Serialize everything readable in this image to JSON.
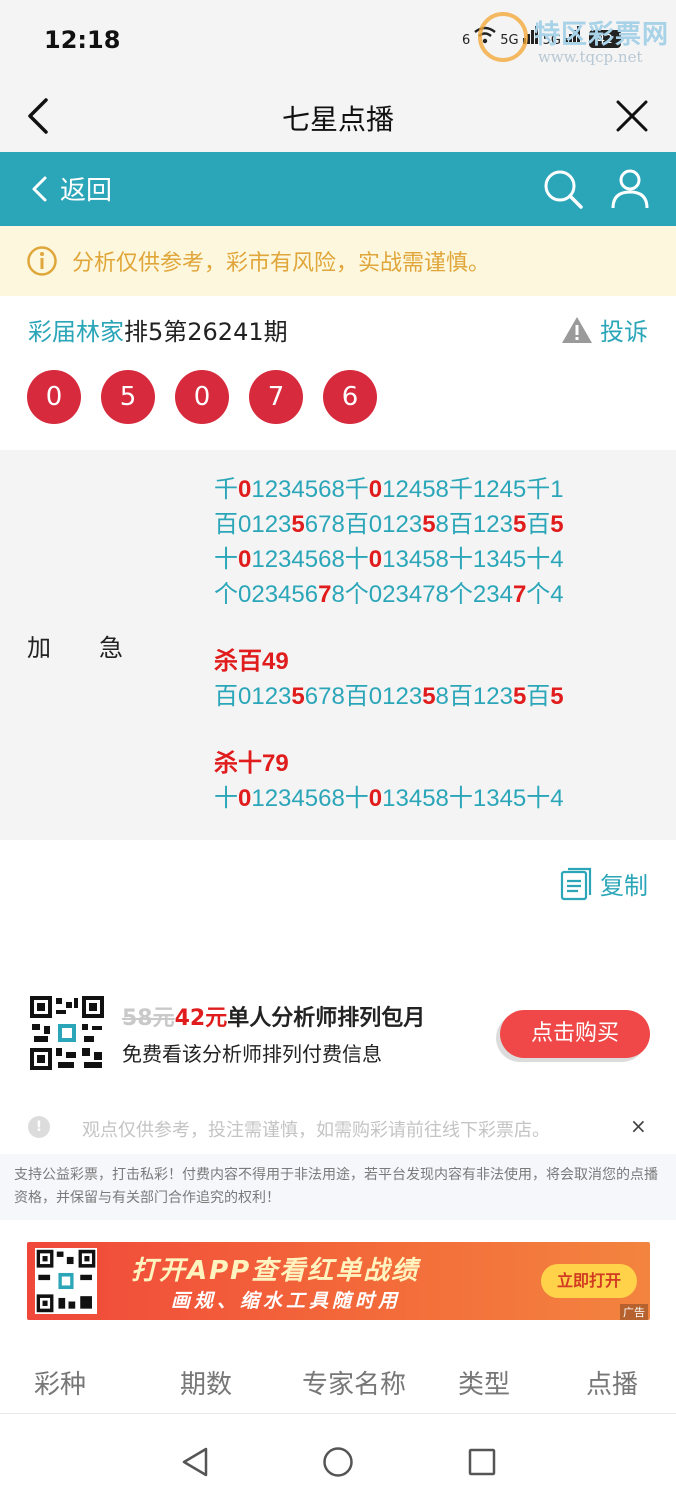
{
  "status": {
    "time": "12:18",
    "net1": "6",
    "net2": "5G",
    "net3": "5G",
    "battery": "42"
  },
  "watermark": {
    "title": "特区彩票网",
    "url": "www.tqcp.net"
  },
  "nav": {
    "title": "七星点播"
  },
  "toolbar": {
    "back_label": "返回"
  },
  "notice": {
    "text": "分析仅供参考，彩市有风险，实战需谨慎。"
  },
  "prediction": {
    "expert_name": "彩届林家",
    "issue_text": "排5第26241期",
    "complaint_label": "投诉",
    "balls": [
      "0",
      "5",
      "0",
      "7",
      "6"
    ],
    "type_label": "加急",
    "lines": {
      "l1": [
        {
          "t": "千"
        },
        {
          "t": "0",
          "r": 1
        },
        {
          "t": "1234568千"
        },
        {
          "t": "0",
          "r": 1
        },
        {
          "t": "12458千1245千1"
        }
      ],
      "l2": [
        {
          "t": "百0123"
        },
        {
          "t": "5",
          "r": 1
        },
        {
          "t": "678百0123"
        },
        {
          "t": "5",
          "r": 1
        },
        {
          "t": "8百123"
        },
        {
          "t": "5",
          "r": 1
        },
        {
          "t": "百"
        },
        {
          "t": "5",
          "r": 1
        }
      ],
      "l3": [
        {
          "t": "十"
        },
        {
          "t": "0",
          "r": 1
        },
        {
          "t": "1234568十"
        },
        {
          "t": "0",
          "r": 1
        },
        {
          "t": "13458十1345十4"
        }
      ],
      "l4": [
        {
          "t": "个023456"
        },
        {
          "t": "7",
          "r": 1
        },
        {
          "t": "8个02347"
        },
        {
          "t": "8个234"
        },
        {
          "t": "7",
          "r": 1
        },
        {
          "t": "个4"
        }
      ],
      "kill1": "杀百49",
      "l5": [
        {
          "t": "百0123"
        },
        {
          "t": "5",
          "r": 1
        },
        {
          "t": "678百0123"
        },
        {
          "t": "5",
          "r": 1
        },
        {
          "t": "8百123"
        },
        {
          "t": "5",
          "r": 1
        },
        {
          "t": "百"
        },
        {
          "t": "5",
          "r": 1
        }
      ],
      "kill2": "杀十79",
      "l6": [
        {
          "t": "十"
        },
        {
          "t": "0",
          "r": 1
        },
        {
          "t": "1234568十"
        },
        {
          "t": "0",
          "r": 1
        },
        {
          "t": "13458十1345十4"
        }
      ]
    },
    "copy_label": "复制"
  },
  "promo": {
    "old_price": "58元",
    "new_price": "42元",
    "title": "单人分析师排列包月",
    "subtitle": "免费看该分析师排列付费信息",
    "buy_label": "点击购买"
  },
  "disclaimer": {
    "text": "观点仅供参考，投注需谨慎，如需购彩请前往线下彩票店。",
    "close": "×"
  },
  "legal": {
    "text": "支持公益彩票，打击私彩！付费内容不得用于非法用途，若平台发现内容有非法使用，将会取消您的点播资格，并保留与有关部门合作追究的权利！"
  },
  "banner": {
    "title": "打开APP查看红单战绩",
    "subtitle": "画规、缩水工具随时用",
    "button": "立即打开",
    "ad": "广告"
  },
  "table_header": [
    "彩种",
    "期数",
    "专家名称",
    "类型",
    "点播"
  ],
  "colors": {
    "teal": "#2ba6b9",
    "ball_red": "#d72a3d",
    "notice_bg": "#fdf7dd",
    "notice_text": "#e0a63a",
    "buy_button": "#f04848"
  }
}
